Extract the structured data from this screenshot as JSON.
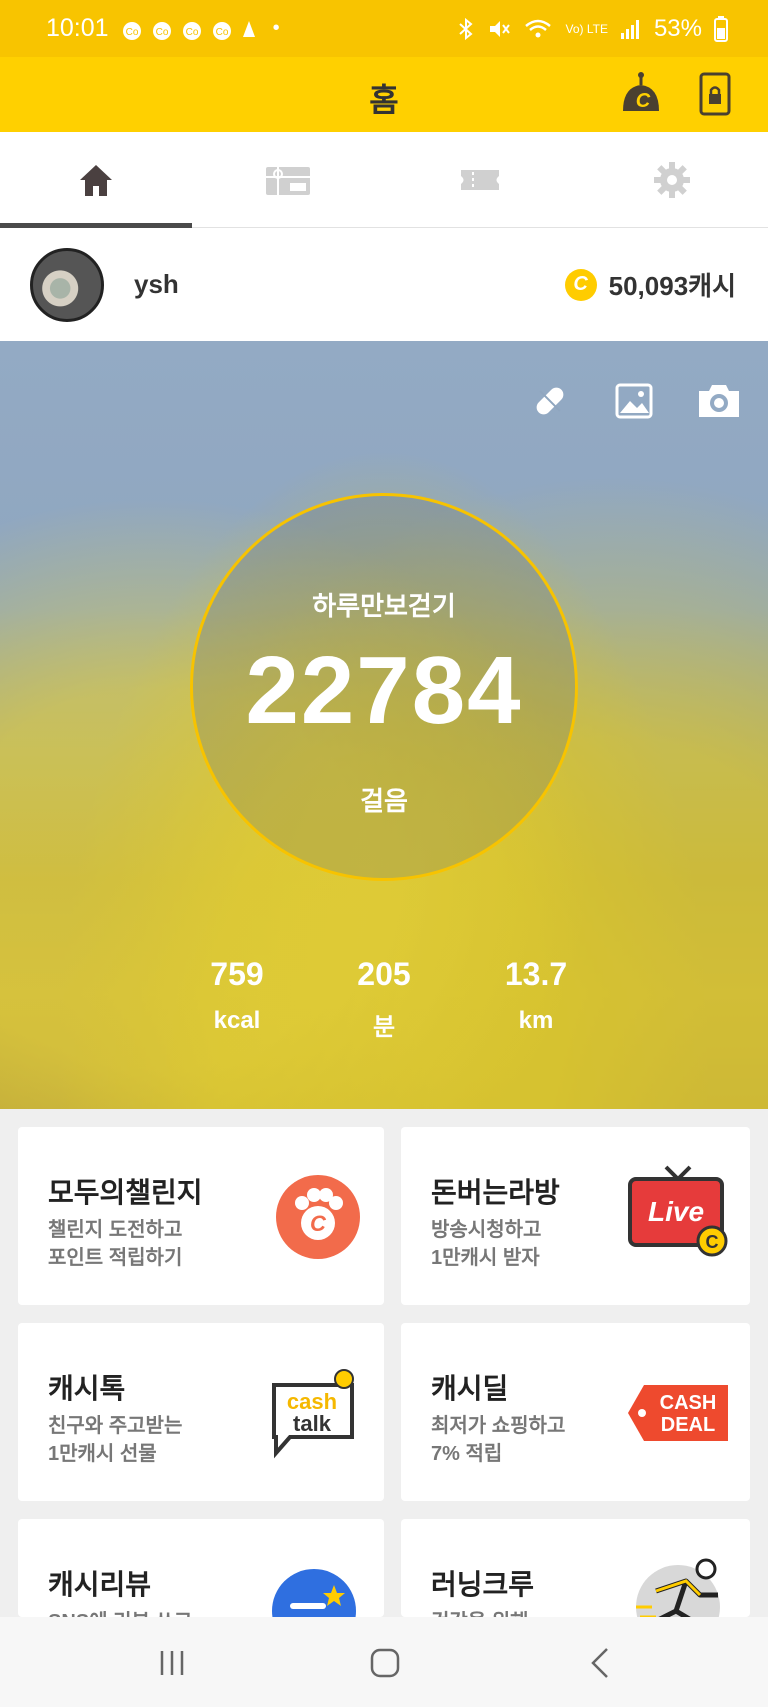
{
  "status": {
    "time": "10:01",
    "battery": "53%",
    "notification_icons": [
      "notification-icon",
      "notification-icon",
      "notification-icon",
      "notification-icon",
      "notification-icon"
    ],
    "signal": "Vo) LTE"
  },
  "header": {
    "title": "홈"
  },
  "tabs": [
    {
      "name": "home",
      "active": true
    },
    {
      "name": "gift",
      "active": false
    },
    {
      "name": "ticket",
      "active": false
    },
    {
      "name": "settings",
      "active": false
    }
  ],
  "profile": {
    "username": "ysh",
    "coin_symbol": "C",
    "cash": "50,093캐시"
  },
  "pedometer": {
    "title": "하루만보걷기",
    "steps": "22784",
    "unit": "걸음",
    "stats": [
      {
        "value": "759",
        "unit": "kcal"
      },
      {
        "value": "205",
        "unit": "분"
      },
      {
        "value": "13.7",
        "unit": "km"
      }
    ]
  },
  "cards": [
    {
      "title": "모두의챌린지",
      "line1": "챌린지 도전하고",
      "line2": "포인트 적립하기",
      "icon": "paw-coin-icon"
    },
    {
      "title": "돈버는라방",
      "line1": "방송시청하고",
      "line2": "1만캐시 받자",
      "icon": "live-tv-icon",
      "badge": "Live"
    },
    {
      "title": "캐시톡",
      "line1": "친구와 주고받는",
      "line2": "1만캐시 선물",
      "icon": "cashtalk-icon",
      "badge": [
        "cash",
        "talk"
      ]
    },
    {
      "title": "캐시딜",
      "line1": "최저가 쇼핑하고",
      "line2": "7% 적립",
      "icon": "cashdeal-icon",
      "badge": [
        "CASH",
        "DEAL"
      ]
    },
    {
      "title": "캐시리뷰",
      "line1": "SNS에 리뷰 쓰고",
      "line2": "",
      "icon": "review-icon"
    },
    {
      "title": "러닝크루",
      "line1": "건강을 위해",
      "line2": "",
      "icon": "running-icon"
    }
  ],
  "colors": {
    "brand_yellow": "#FFD000",
    "status_yellow": "#F8C400",
    "coin": "#FFCC00",
    "accent_orange": "#F26B4B",
    "live_red": "#E63B3B"
  }
}
